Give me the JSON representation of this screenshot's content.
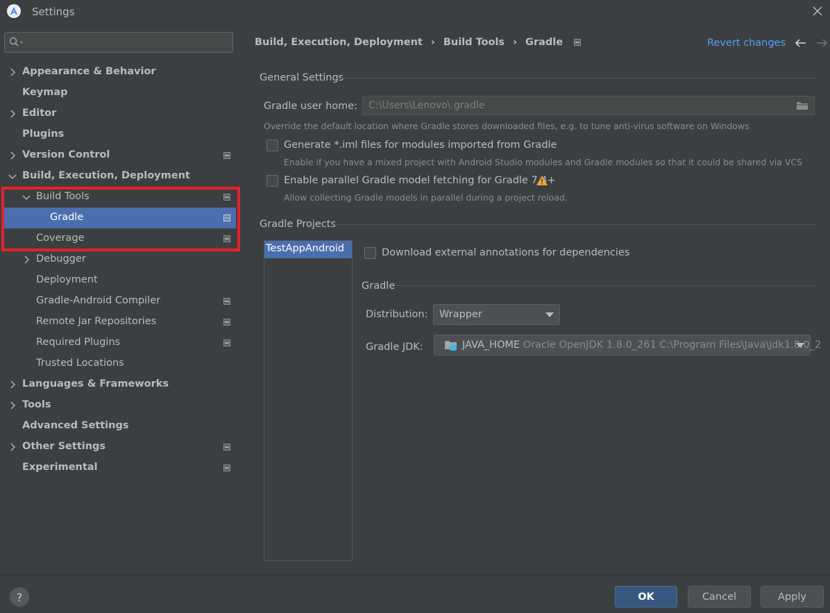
{
  "window": {
    "title": "Settings"
  },
  "search": {
    "placeholder": ""
  },
  "sidebar": {
    "items": [
      {
        "label": "Appearance & Behavior",
        "bold": true,
        "expandable": true,
        "expanded": false,
        "indent": 0,
        "project": false
      },
      {
        "label": "Keymap",
        "bold": true,
        "expandable": false,
        "indent": 0,
        "project": false
      },
      {
        "label": "Editor",
        "bold": true,
        "expandable": true,
        "expanded": false,
        "indent": 0,
        "project": false
      },
      {
        "label": "Plugins",
        "bold": true,
        "expandable": false,
        "indent": 0,
        "project": false
      },
      {
        "label": "Version Control",
        "bold": true,
        "expandable": true,
        "expanded": false,
        "indent": 0,
        "project": true
      },
      {
        "label": "Build, Execution, Deployment",
        "bold": true,
        "expandable": true,
        "expanded": true,
        "indent": 0,
        "project": false
      },
      {
        "label": "Build Tools",
        "bold": false,
        "expandable": true,
        "expanded": true,
        "indent": 1,
        "project": true
      },
      {
        "label": "Gradle",
        "bold": false,
        "expandable": false,
        "indent": 2,
        "project": true,
        "selected": true
      },
      {
        "label": "Coverage",
        "bold": false,
        "expandable": false,
        "indent": 1,
        "project": true
      },
      {
        "label": "Debugger",
        "bold": false,
        "expandable": true,
        "expanded": false,
        "indent": 1,
        "project": false
      },
      {
        "label": "Deployment",
        "bold": false,
        "expandable": false,
        "indent": 1,
        "project": false
      },
      {
        "label": "Gradle-Android Compiler",
        "bold": false,
        "expandable": false,
        "indent": 1,
        "project": true
      },
      {
        "label": "Remote Jar Repositories",
        "bold": false,
        "expandable": false,
        "indent": 1,
        "project": true
      },
      {
        "label": "Required Plugins",
        "bold": false,
        "expandable": false,
        "indent": 1,
        "project": true
      },
      {
        "label": "Trusted Locations",
        "bold": false,
        "expandable": false,
        "indent": 1,
        "project": false
      },
      {
        "label": "Languages & Frameworks",
        "bold": true,
        "expandable": true,
        "expanded": false,
        "indent": 0,
        "project": false
      },
      {
        "label": "Tools",
        "bold": true,
        "expandable": true,
        "expanded": false,
        "indent": 0,
        "project": false
      },
      {
        "label": "Advanced Settings",
        "bold": true,
        "expandable": false,
        "indent": 0,
        "project": false
      },
      {
        "label": "Other Settings",
        "bold": true,
        "expandable": true,
        "expanded": false,
        "indent": 0,
        "project": true
      },
      {
        "label": "Experimental",
        "bold": true,
        "expandable": false,
        "indent": 0,
        "project": true
      }
    ]
  },
  "breadcrumb": {
    "items": [
      "Build, Execution, Deployment",
      "Build Tools",
      "Gradle"
    ],
    "separator": "›"
  },
  "header": {
    "revert_label": "Revert changes"
  },
  "general": {
    "title": "General Settings",
    "gradle_home_label": "Gradle user home:",
    "gradle_home_value": "C:\\Users\\Lenovo\\.gradle",
    "gradle_home_hint": "Override the default location where Gradle stores downloaded files, e.g. to tune anti-virus software on Windows",
    "iml_label": "Generate *.iml files for modules imported from Gradle",
    "iml_checked": false,
    "iml_hint": "Enable if you have a mixed project with Android Studio modules and Gradle modules so that it could be shared via VCS",
    "parallel_label": "Enable parallel Gradle model fetching for Gradle 7.4+",
    "parallel_checked": false,
    "parallel_hint": "Allow collecting Gradle models in parallel during a project reload."
  },
  "projects": {
    "title": "Gradle Projects",
    "items": [
      "TestAppAndroid"
    ],
    "annotations_label": "Download external annotations for dependencies",
    "annotations_checked": false,
    "gradle_title": "Gradle",
    "distribution_label": "Distribution:",
    "distribution_value": "Wrapper",
    "jdk_label": "Gradle JDK:",
    "jdk_name": "JAVA_HOME",
    "jdk_detail": "Oracle OpenJDK 1.8.0_261 C:\\Program Files\\Java\\jdk1.8.0_2"
  },
  "footer": {
    "help_label": "?",
    "ok_label": "OK",
    "cancel_label": "Cancel",
    "apply_label": "Apply"
  },
  "colors": {
    "background": "#3c3f41",
    "selection": "#4b6eaf",
    "link": "#589df6",
    "highlight_border": "#e8202a",
    "primary_button": "#365880",
    "warning": "#f0a732"
  }
}
